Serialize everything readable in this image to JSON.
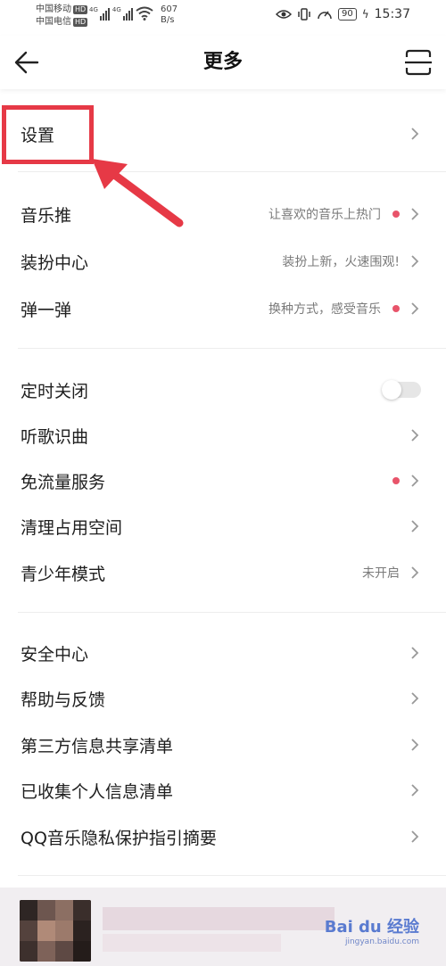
{
  "status_bar": {
    "carrier1": "中国移动",
    "carrier2": "中国电信",
    "hd": "HD",
    "net_type": "4G",
    "speed_value": "607",
    "speed_unit": "B/s",
    "battery": "90",
    "time": "15:37"
  },
  "header": {
    "title": "更多"
  },
  "sections": [
    {
      "items": [
        {
          "label": "设置"
        }
      ]
    },
    {
      "items": [
        {
          "label": "音乐推",
          "sub": "让喜欢的音乐上热门"
        },
        {
          "label": "装扮中心",
          "sub": "装扮上新，火速围观!"
        },
        {
          "label": "弹一弹",
          "sub": "换种方式，感受音乐"
        }
      ]
    },
    {
      "items": [
        {
          "label": "定时关闭"
        },
        {
          "label": "听歌识曲"
        },
        {
          "label": "免流量服务"
        },
        {
          "label": "清理占用空间"
        },
        {
          "label": "青少年模式",
          "sub": "未开启"
        }
      ]
    },
    {
      "items": [
        {
          "label": "安全中心"
        },
        {
          "label": "帮助与反馈"
        },
        {
          "label": "第三方信息共享清单"
        },
        {
          "label": "已收集个人信息清单"
        },
        {
          "label": "QQ音乐隐私保护指引摘要"
        }
      ]
    }
  ],
  "timer_toggle_on": false,
  "colors": {
    "accent_dot": "#e8546a",
    "annotation": "#e63946"
  },
  "watermark": {
    "brand": "Bai du 经验",
    "url": "jingyan.baidu.com"
  }
}
